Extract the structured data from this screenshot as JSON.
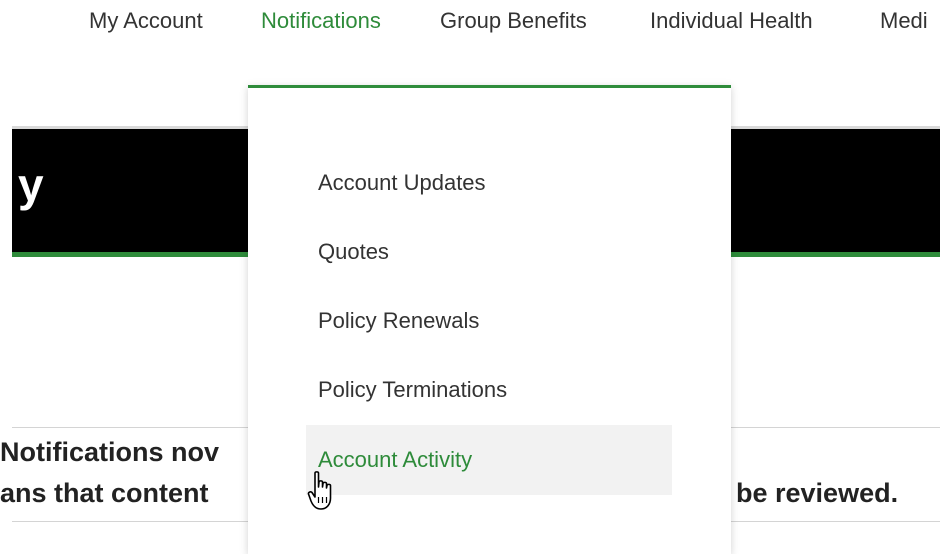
{
  "topnav": {
    "items": [
      {
        "label": "My Account",
        "active": false
      },
      {
        "label": "Notifications",
        "active": true
      },
      {
        "label": "Group Benefits",
        "active": false
      },
      {
        "label": "Individual Health",
        "active": false
      },
      {
        "label": "Medi",
        "active": false
      }
    ]
  },
  "hero": {
    "title_fragment": "y"
  },
  "notice": {
    "line1": "Notifications nov",
    "line2": "ans that content",
    "line3": "be reviewed."
  },
  "dropdown": {
    "items": [
      {
        "label": "Account Updates"
      },
      {
        "label": "Quotes"
      },
      {
        "label": "Policy Renewals"
      },
      {
        "label": "Policy Terminations"
      },
      {
        "label": "Account Activity",
        "hovered": true
      }
    ]
  },
  "theme": {
    "accent": "#2e8b3a",
    "hero_bg": "#000000",
    "text": "#333333"
  },
  "cursor": {
    "icon": "hand-pointer-icon"
  }
}
